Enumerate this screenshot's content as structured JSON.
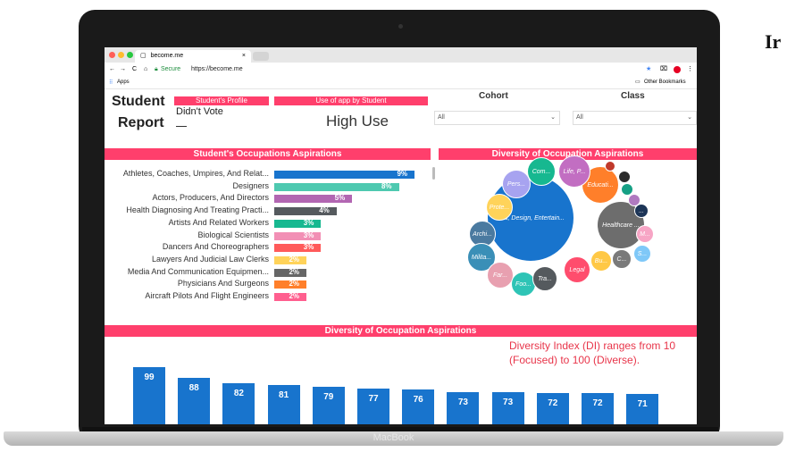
{
  "outside_text": "Ir",
  "laptop": {
    "brand": "MacBook"
  },
  "browser": {
    "tab_title": "become.me",
    "secure_label": "Secure",
    "url": "https://become.me",
    "apps_label": "Apps",
    "other_bookmarks": "Other Bookmarks"
  },
  "header": {
    "report_title_1": "Student",
    "report_title_2": "Report",
    "tab_profile": "Student's Profile",
    "tab_use": "Use of app by Student",
    "vote_status": "Didn't Vote",
    "use_level": "High Use",
    "cohort_label": "Cohort",
    "cohort_value": "All",
    "class_label": "Class",
    "class_value": "All"
  },
  "colors": {
    "accent": "#ff3f6c",
    "bar_blue": "#1874cd"
  },
  "occupations": {
    "title": "Student's Occupations Aspirations",
    "items": [
      {
        "label": "Athletes, Coaches, Umpires, And Relat...",
        "value": "9%",
        "pct": 9,
        "color": "#1874cd"
      },
      {
        "label": "Designers",
        "value": "8%",
        "pct": 8,
        "color": "#4ec9b0"
      },
      {
        "label": "Actors, Producers, And Directors",
        "value": "5%",
        "pct": 5,
        "color": "#b266b2"
      },
      {
        "label": "Health Diagnosing And Treating Practi...",
        "value": "4%",
        "pct": 4,
        "color": "#555a5e"
      },
      {
        "label": "Artists And Related Workers",
        "value": "3%",
        "pct": 3,
        "color": "#17b890"
      },
      {
        "label": "Biological Scientists",
        "value": "3%",
        "pct": 3,
        "color": "#f28fb5"
      },
      {
        "label": "Dancers And Choreographers",
        "value": "3%",
        "pct": 3,
        "color": "#ff5a5a"
      },
      {
        "label": "Lawyers And Judicial Law Clerks",
        "value": "2%",
        "pct": 2,
        "color": "#ffd35a"
      },
      {
        "label": "Media And Communication Equipmen...",
        "value": "2%",
        "pct": 2,
        "color": "#666666"
      },
      {
        "label": "Physicians And Surgeons",
        "value": "2%",
        "pct": 2,
        "color": "#ff7f2a"
      },
      {
        "label": "Aircraft Pilots And Flight Engineers",
        "value": "2%",
        "pct": 2,
        "color": "#ff5f8f"
      }
    ]
  },
  "bubbles": {
    "title": "Diversity of Occupation Aspirations",
    "items": [
      {
        "label": "Arts, Design, Entertain...",
        "color": "#1874cd"
      },
      {
        "label": "Healthcare ...",
        "color": "#6d6d6d"
      },
      {
        "label": "Educati...",
        "color": "#ff7f2a"
      },
      {
        "label": "Life, P...",
        "color": "#c26ec2"
      },
      {
        "label": "Com...",
        "color": "#17b890"
      },
      {
        "label": "Pers...",
        "color": "#a7a3f0"
      },
      {
        "label": "Prote...",
        "color": "#ffd35a"
      },
      {
        "label": "Archi...",
        "color": "#4a7aa0"
      },
      {
        "label": "Milita...",
        "color": "#3a8fb7"
      },
      {
        "label": "Far...",
        "color": "#e8a0b0"
      },
      {
        "label": "Foo...",
        "color": "#2ec4b6"
      },
      {
        "label": "Tra...",
        "color": "#555a5e"
      },
      {
        "label": "Legal",
        "color": "#ff4d6d"
      },
      {
        "label": "Bu...",
        "color": "#ffc845"
      },
      {
        "label": "C...",
        "color": "#7a7a7a"
      },
      {
        "label": "M...",
        "color": "#f7a5c5"
      },
      {
        "label": "S...",
        "color": "#7fc8f8"
      },
      {
        "label": "...",
        "color": "#1d3557"
      },
      {
        "label": "",
        "color": "#c0392b"
      },
      {
        "label": "",
        "color": "#2c2c2c"
      },
      {
        "label": "",
        "color": "#16a085"
      },
      {
        "label": "",
        "color": "#b07ac0"
      }
    ]
  },
  "diversity": {
    "title": "Diversity of Occupation Aspirations",
    "note_1": "Diversity Index (DI) ranges from 10",
    "note_2": "(Focused) to 100 (Diverse).",
    "values": [
      99,
      88,
      82,
      81,
      79,
      77,
      76,
      73,
      73,
      72,
      72,
      71
    ]
  }
}
